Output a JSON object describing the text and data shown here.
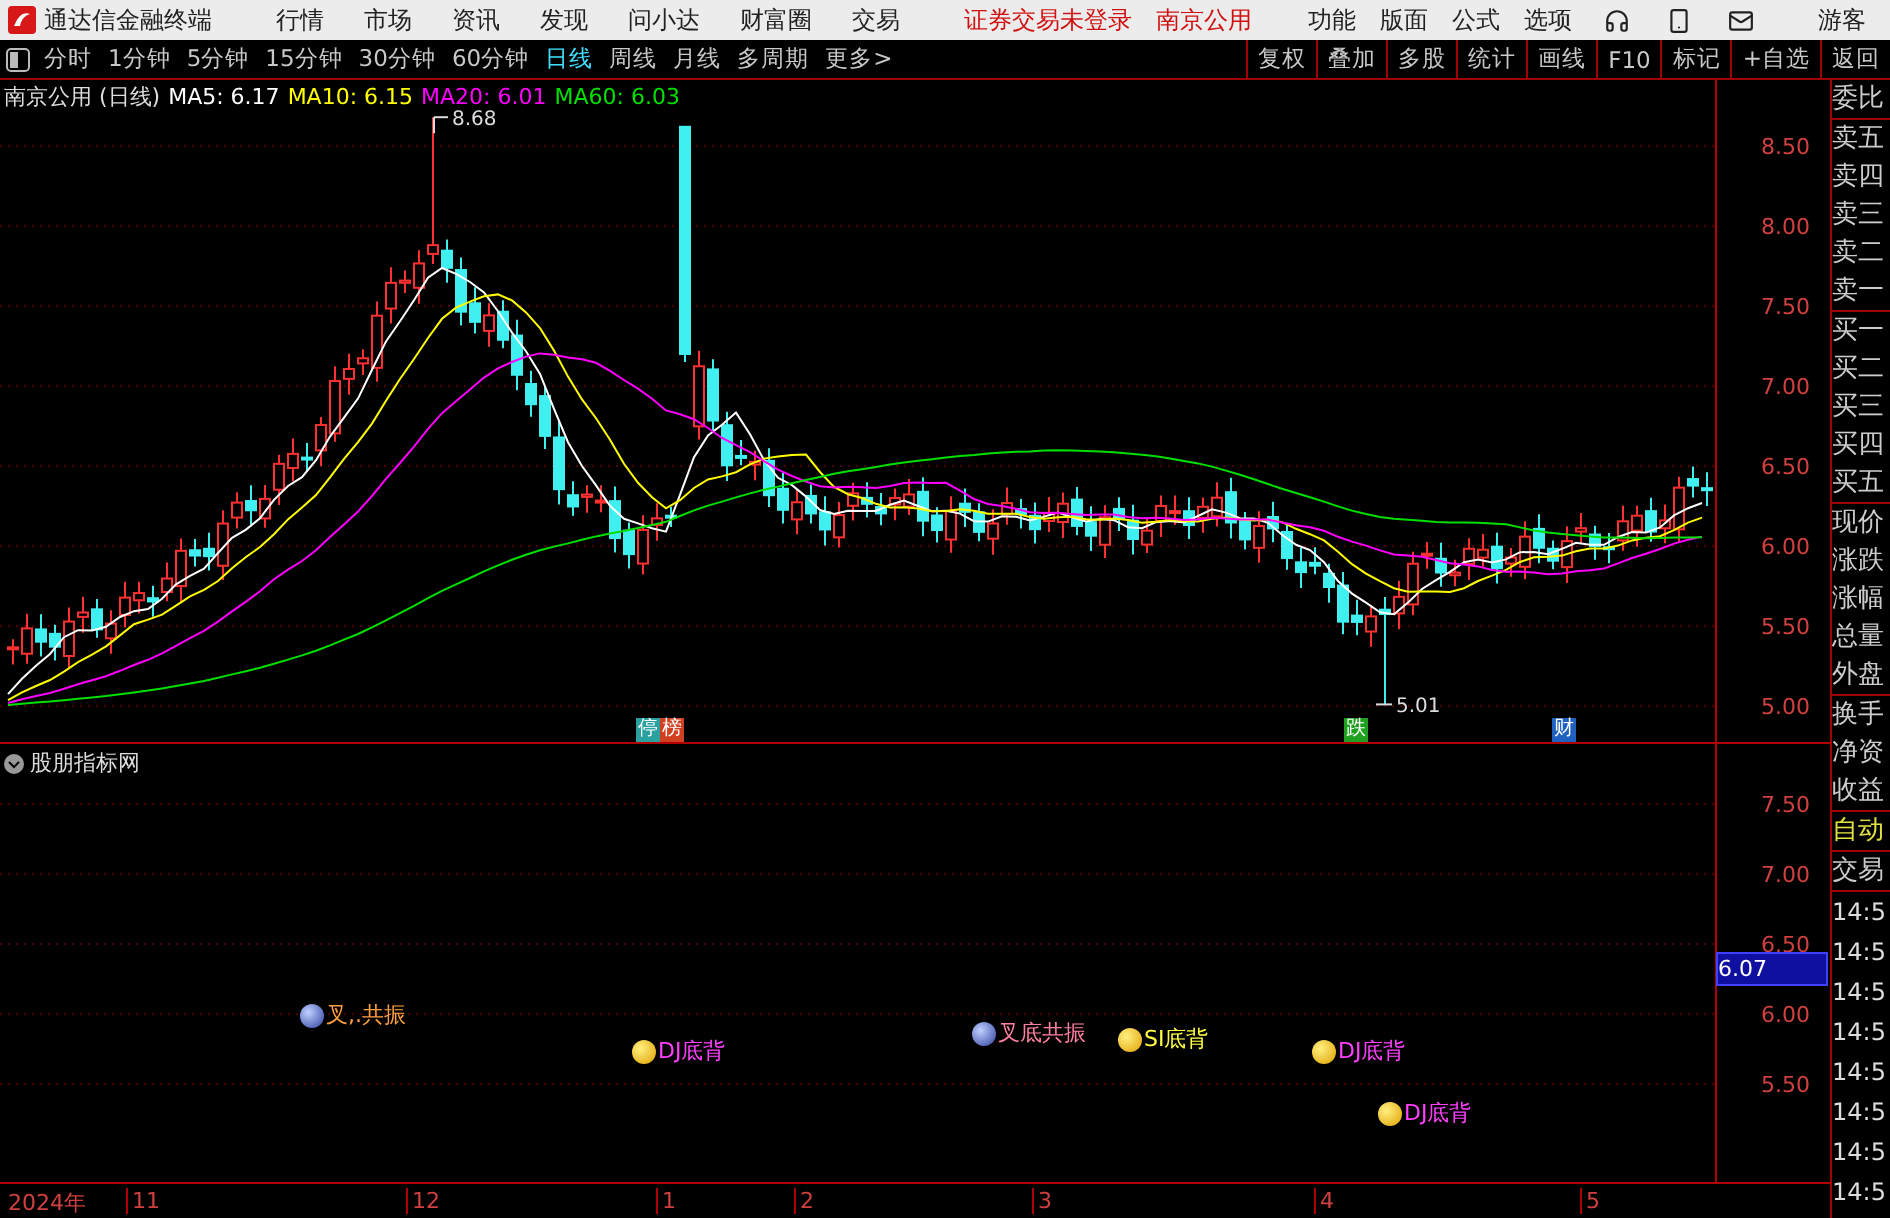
{
  "app": {
    "title": "通达信金融终端",
    "menus": [
      "行情",
      "市场",
      "资讯",
      "发现",
      "问小达",
      "财富圈",
      "交易"
    ],
    "notices": [
      "证券交易未登录",
      "南京公用"
    ],
    "tools": [
      "功能",
      "版面",
      "公式",
      "选项"
    ],
    "user": "游客"
  },
  "period_bar": {
    "periods": [
      {
        "label": "分时",
        "selected": false
      },
      {
        "label": "1分钟",
        "selected": false
      },
      {
        "label": "5分钟",
        "selected": false
      },
      {
        "label": "15分钟",
        "selected": false
      },
      {
        "label": "30分钟",
        "selected": false
      },
      {
        "label": "60分钟",
        "selected": false
      },
      {
        "label": "日线",
        "selected": true
      },
      {
        "label": "周线",
        "selected": false
      },
      {
        "label": "月线",
        "selected": false
      },
      {
        "label": "多周期",
        "selected": false
      }
    ],
    "more": "更多>",
    "buttons": [
      "复权",
      "叠加",
      "多股",
      "统计",
      "画线",
      "F10",
      "标记",
      "+自选",
      "返回"
    ]
  },
  "price_chart": {
    "legend": {
      "name": "南京公用 (日线)",
      "averages": [
        {
          "label": "MA5: 6.17",
          "color": "#ffffff"
        },
        {
          "label": "MA10: 6.15",
          "color": "#ffff00"
        },
        {
          "label": "MA20: 6.01",
          "color": "#ff00ff"
        },
        {
          "label": "MA60: 6.03",
          "color": "#00e000"
        }
      ]
    },
    "high_label": "8.68",
    "low_label": "5.01",
    "markers": [
      {
        "text": "停",
        "color": "#2aa0a0"
      },
      {
        "text": "榜",
        "color": "#d04020"
      },
      {
        "text": "跌",
        "color": "#20a020"
      },
      {
        "text": "财",
        "color": "#2060c0"
      }
    ],
    "yticks": [
      "8.50",
      "8.00",
      "7.50",
      "7.00",
      "6.50",
      "6.00",
      "5.50",
      "5.00"
    ]
  },
  "indicator_panel": {
    "title": "股朋指标网",
    "signals": [
      {
        "kind": "cross",
        "text": "叉,.共振",
        "color": "#ffa040"
      },
      {
        "kind": "face",
        "text": "DJ底背",
        "color": "#ff40ff"
      },
      {
        "kind": "cross",
        "text": "叉底共振",
        "color": "#ff80a0"
      },
      {
        "kind": "face",
        "text": "SI底背",
        "color": "#ffff40"
      },
      {
        "kind": "face",
        "text": "DJ底背",
        "color": "#ff40ff"
      },
      {
        "kind": "face",
        "text": "DJ底背",
        "color": "#ff40ff"
      }
    ],
    "yticks": [
      "7.50",
      "7.00",
      "6.50",
      "6.00",
      "5.50"
    ],
    "cursor_value": "6.07"
  },
  "time_axis": [
    "2024年",
    "11",
    "12",
    "1",
    "2",
    "3",
    "4",
    "5"
  ],
  "quote_panel": {
    "groups": [
      [
        "委比"
      ],
      [
        "卖五",
        "卖四",
        "卖三",
        "卖二",
        "卖一"
      ],
      [
        "买一",
        "买二",
        "买三",
        "买四",
        "买五"
      ],
      [
        "现价",
        "涨跌",
        "涨幅",
        "总量",
        "外盘"
      ],
      [
        "换手",
        "净资",
        "收益"
      ]
    ]
  },
  "trade_panel": {
    "tabs": [
      "自动",
      "交易"
    ],
    "times": [
      "14:5",
      "14:5",
      "14:5",
      "14:5",
      "14:5",
      "14:5",
      "14:5",
      "14:5"
    ]
  }
}
